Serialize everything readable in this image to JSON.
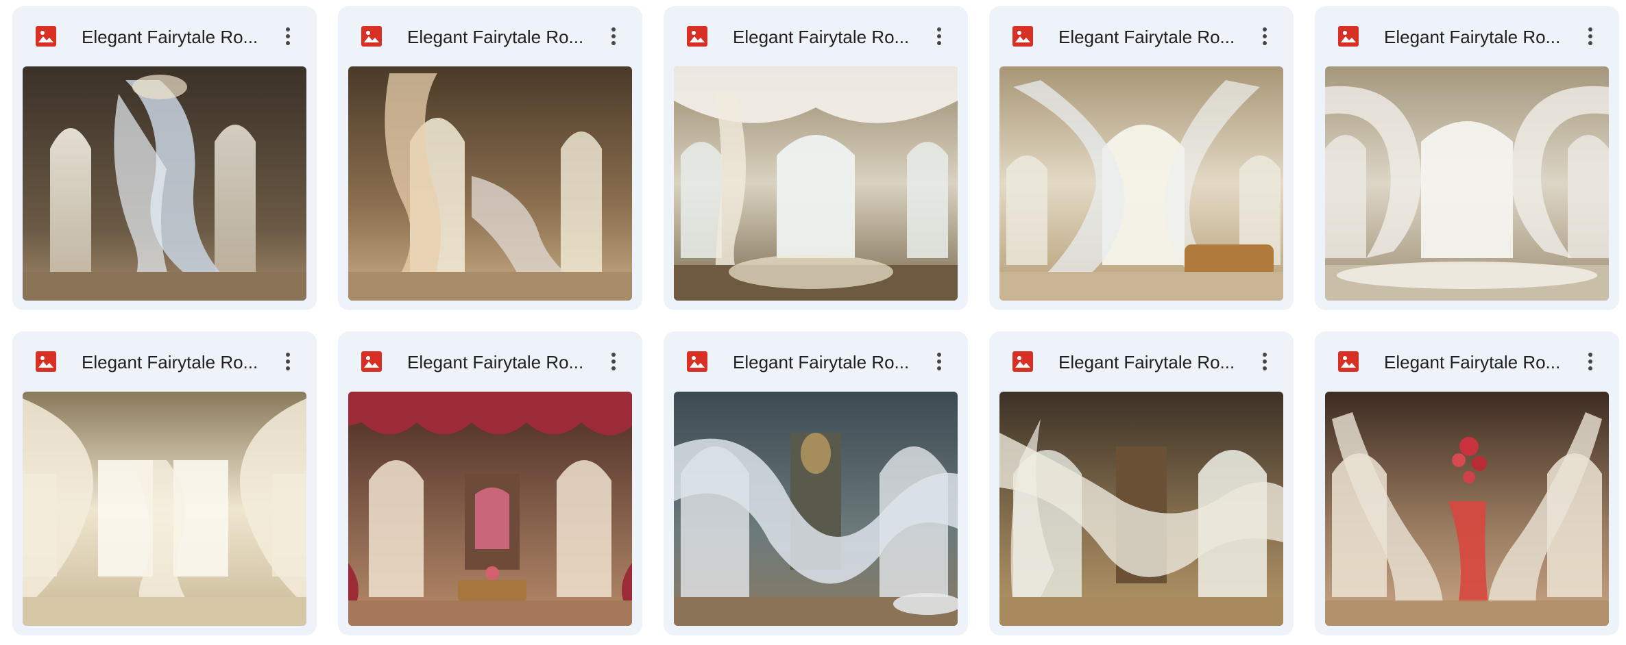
{
  "files": [
    {
      "name": "Elegant Fairytale Ro...",
      "icon": "image-file-icon",
      "theme": "warm-dark-blue-drape"
    },
    {
      "name": "Elegant Fairytale Ro...",
      "icon": "image-file-icon",
      "theme": "golden-arch"
    },
    {
      "name": "Elegant Fairytale Ro...",
      "icon": "image-file-icon",
      "theme": "bright-white-drapes"
    },
    {
      "name": "Elegant Fairytale Ro...",
      "icon": "image-file-icon",
      "theme": "sunlit-sheer"
    },
    {
      "name": "Elegant Fairytale Ro...",
      "icon": "image-file-icon",
      "theme": "pale-cream"
    },
    {
      "name": "Elegant Fairytale Ro...",
      "icon": "image-file-icon",
      "theme": "cream-mist"
    },
    {
      "name": "Elegant Fairytale Ro...",
      "icon": "image-file-icon",
      "theme": "red-velvet"
    },
    {
      "name": "Elegant Fairytale Ro...",
      "icon": "image-file-icon",
      "theme": "blue-grey-palace"
    },
    {
      "name": "Elegant Fairytale Ro...",
      "icon": "image-file-icon",
      "theme": "gold-ornate"
    },
    {
      "name": "Elegant Fairytale Ro...",
      "icon": "image-file-icon",
      "theme": "red-blossom"
    }
  ],
  "colors": {
    "card_bg": "#eef2f9",
    "title_text": "#1f1f1f",
    "file_icon_red": "#d93025",
    "more_icon": "#444746"
  }
}
